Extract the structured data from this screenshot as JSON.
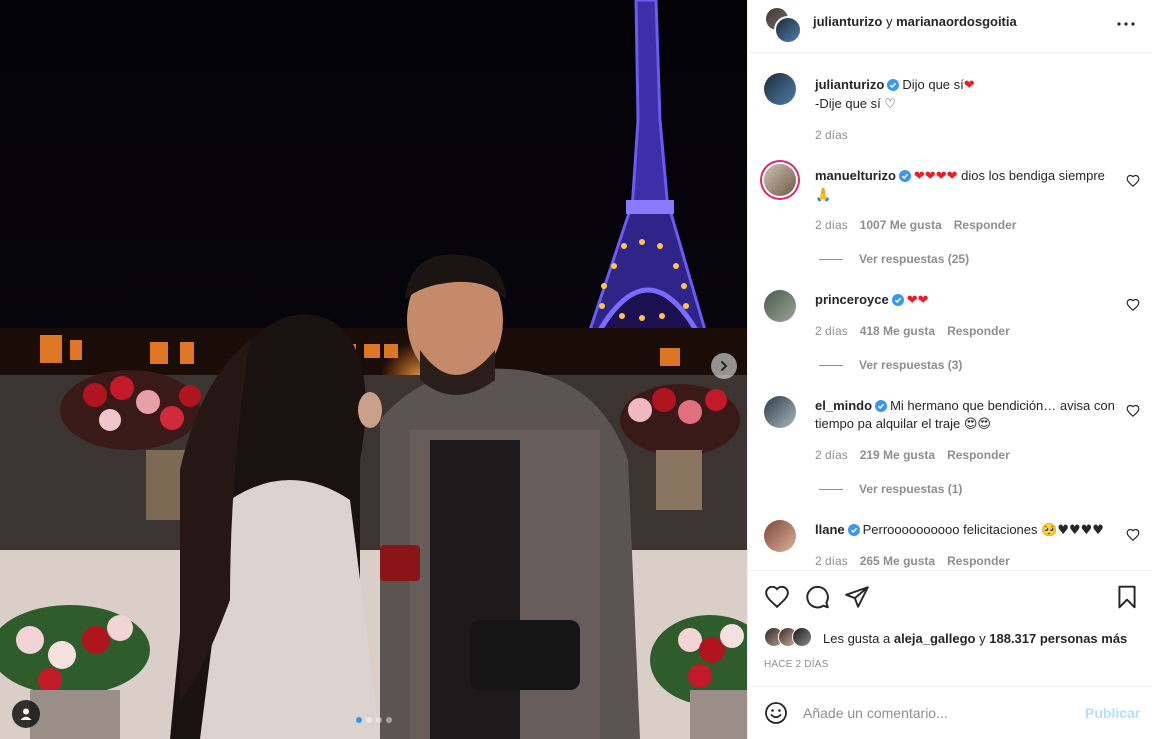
{
  "post": {
    "media": {
      "alt": "Photo",
      "carousel_count": 4,
      "carousel_active_index": 0,
      "next_icon": "chevron-right-icon",
      "tag_icon": "user-tag-icon"
    },
    "header": {
      "user1": "julianturizo",
      "conjunction": "y",
      "user2": "marianaordosgoitia",
      "more_icon": "more-horizontal-icon"
    },
    "caption": {
      "username": "julianturizo",
      "line1": "Dijo que sí",
      "line1_emoji": "❤",
      "line2": "-Dije que sí",
      "line2_emoji": "♡",
      "time": "2 días"
    },
    "comments": [
      {
        "username": "manuelturizo",
        "text": "dios los bendiga siempre",
        "pre_emoji": "❤❤❤❤",
        "post_emoji": "🙏",
        "time": "2 días",
        "likes": "1007 Me gusta",
        "reply": "Responder",
        "view_replies": "Ver respuestas (25)"
      },
      {
        "username": "princeroyce",
        "text": "",
        "pre_emoji": "❤❤",
        "post_emoji": "",
        "time": "2 días",
        "likes": "418 Me gusta",
        "reply": "Responder",
        "view_replies": "Ver respuestas (3)"
      },
      {
        "username": "el_mindo",
        "text": "Mi hermano que bendición… avisa con tiempo pa alquilar el traje",
        "pre_emoji": "",
        "post_emoji": "😍😍",
        "time": "2 días",
        "likes": "219 Me gusta",
        "reply": "Responder",
        "view_replies": "Ver respuestas (1)"
      },
      {
        "username": "llane",
        "text": "Perroooooooooo felicitaciones",
        "pre_emoji": "",
        "post_emoji": "🥺♥♥♥♥",
        "time": "2 días",
        "likes": "265 Me gusta",
        "reply": "Responder",
        "view_replies": ""
      }
    ],
    "actions": {
      "like_icon": "heart-icon",
      "comment_icon": "comment-icon",
      "share_icon": "paper-plane-icon",
      "save_icon": "bookmark-icon"
    },
    "likes": {
      "prefix": "Les gusta a",
      "user": "aleja_gallego",
      "middle": "y",
      "count": "188.317 personas más"
    },
    "time_ago": "HACE 2 DÍAS",
    "add_comment": {
      "placeholder": "Añade un comentario...",
      "publish": "Publicar",
      "emoji_icon": "smiley-icon"
    },
    "colors": {
      "link_blue": "#0095f6",
      "publish_disabled": "#b2dffc",
      "verified_blue": "#3897f0",
      "muted_text": "#8e8e8e"
    }
  }
}
